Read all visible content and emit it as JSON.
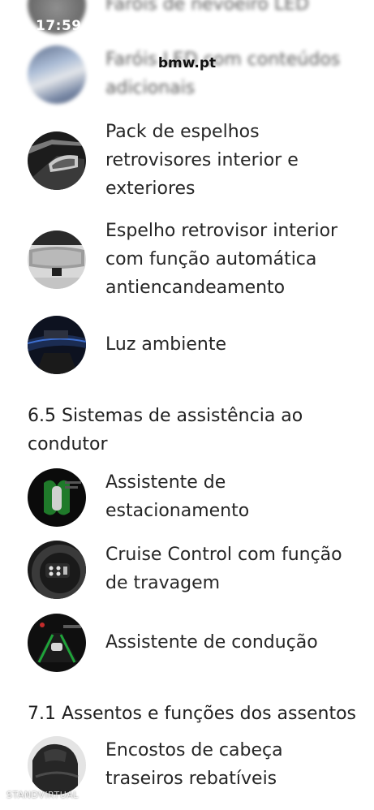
{
  "status_bar": {
    "time": "17:59"
  },
  "browser": {
    "url": "bmw.pt"
  },
  "items_top": [
    {
      "lines": [
        "Faróis de nevoeiro LED"
      ]
    },
    {
      "lines": [
        "Faróis LED com conteúdos",
        "adicionais"
      ]
    },
    {
      "lines": [
        "Pack de espelhos",
        "retrovisores interior e",
        "exteriores"
      ]
    },
    {
      "lines": [
        "Espelho retrovisor interior",
        "com função automática",
        "antiencandeamento"
      ]
    },
    {
      "lines": [
        "Luz ambiente"
      ]
    }
  ],
  "section_6_5": {
    "lines": [
      "6.5 Sistemas de assistência ao",
      "condutor"
    ]
  },
  "items_assist": [
    {
      "lines": [
        "Assistente de",
        "estacionamento"
      ]
    },
    {
      "lines": [
        "Cruise Control com função",
        "de travagem"
      ]
    },
    {
      "lines": [
        "Assistente de condução"
      ]
    }
  ],
  "section_7_1": {
    "lines": [
      "7.1 Assentos e funções dos assentos"
    ]
  },
  "items_seats": [
    {
      "lines": [
        "Encostos de cabeça",
        "traseiros rebatíveis"
      ]
    }
  ],
  "watermark": "STANDVIRTUAL",
  "colors": {
    "text": "#262626",
    "background": "#ffffff"
  }
}
